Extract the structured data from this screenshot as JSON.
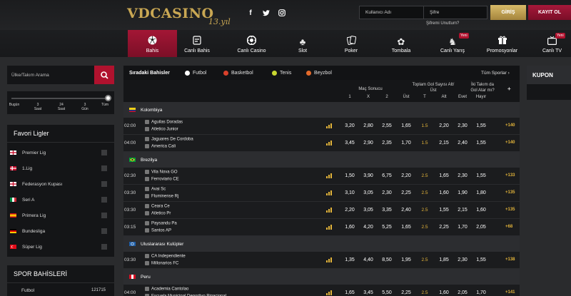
{
  "header": {
    "logo_text": "VDCASINO",
    "logo_sub": "13.yıl",
    "social": [
      "facebook-icon",
      "twitter-icon",
      "instagram-icon"
    ],
    "username_placeholder": "Kullanıcı Adı",
    "password_placeholder": "Şifre",
    "forgot_text": "Şifremi Unuttum?",
    "login_label": "GİRİŞ",
    "register_label": "KAYIT OL"
  },
  "nav": [
    {
      "label": "Bahis",
      "icon": "soccer-ball-icon",
      "active": true
    },
    {
      "label": "Canlı Bahis",
      "icon": "live-bet-icon"
    },
    {
      "label": "Canlı Casino",
      "icon": "casino-chip-icon"
    },
    {
      "label": "Slot",
      "icon": "slot-icon"
    },
    {
      "label": "Poker",
      "icon": "poker-cards-icon"
    },
    {
      "label": "Tombala",
      "icon": "tombala-icon"
    },
    {
      "label": "Canlı Yarış",
      "icon": "horse-icon",
      "badge": "Yeni"
    },
    {
      "label": "Promosyonlar",
      "icon": "gift-icon"
    },
    {
      "label": "Canlı TV",
      "icon": "tv-icon",
      "badge": "Yeni"
    }
  ],
  "sidebar": {
    "search_placeholder": "Ülke/Takım Arama",
    "time_labels": [
      {
        "l1": "Bugün",
        "l2": ""
      },
      {
        "l1": "3",
        "l2": "Saat"
      },
      {
        "l1": "24",
        "l2": "Saat"
      },
      {
        "l1": "3",
        "l2": "Gün"
      },
      {
        "l1": "Tüm",
        "l2": ""
      }
    ],
    "fav_title": "Favori Ligler",
    "fav_leagues": [
      {
        "name": "Premier Lig",
        "flag": "england"
      },
      {
        "name": "1.Lig",
        "flag": "denmark"
      },
      {
        "name": "Federasyon Kupası",
        "flag": "england"
      },
      {
        "name": "Seri A",
        "flag": "italy"
      },
      {
        "name": "Primera Lig",
        "flag": "spain"
      },
      {
        "name": "Bundesliga",
        "flag": "germany"
      },
      {
        "name": "Süper Lig",
        "flag": "turkey"
      }
    ],
    "spor_title": "SPOR BAHİSLERİ",
    "spor_items": [
      {
        "name": "Futbol",
        "count": "121715"
      }
    ]
  },
  "main": {
    "title": "Sıradaki Bahisler",
    "sports": [
      {
        "label": "Futbol",
        "color": "#ffffff"
      },
      {
        "label": "Basketbol",
        "color": "#d9402b"
      },
      {
        "label": "Tenis",
        "color": "#c8d630"
      },
      {
        "label": "Beyzbol",
        "color": "#e36a2a"
      }
    ],
    "all_sports": "Tüm Sporlar ›",
    "col_groups": {
      "mac_sonucu": "Maç Sonucu",
      "gol_l1": "Toplam Gol Sayısı Alt/",
      "gol_l2": "Üst",
      "kg_l1": "İki Takım da",
      "kg_l2": "Gol Atar mı?",
      "plus": "+"
    },
    "sub_heads": [
      "1",
      "X",
      "2",
      "Üst",
      "T",
      "Alt",
      "Evet",
      "Hayır"
    ],
    "leagues": [
      {
        "name": "Kolombiya",
        "flag": "colombia",
        "matches": [
          {
            "time": "02:00",
            "home": "Aguilas Doradas",
            "away": "Atletico Junior",
            "odds": [
              "3,20",
              "2,80",
              "2,55",
              "1,65",
              "1.5",
              "2,20",
              "2,30",
              "1,55"
            ],
            "more": "+140"
          },
          {
            "time": "04:00",
            "home": "Jaguares De Cordoba",
            "away": "America Cali",
            "odds": [
              "3,45",
              "2,90",
              "2,35",
              "1,70",
              "1.5",
              "2,15",
              "2,40",
              "1,55"
            ],
            "more": "+140"
          }
        ]
      },
      {
        "name": "Brezilya",
        "flag": "brazil",
        "matches": [
          {
            "time": "02:30",
            "home": "Vila Nova GO",
            "away": "Ferroviario CE",
            "odds": [
              "1,50",
              "3,90",
              "6,75",
              "2,20",
              "2.5",
              "1,65",
              "2,30",
              "1,55"
            ],
            "more": "+133"
          },
          {
            "time": "03:30",
            "home": "Avai Sc",
            "away": "Fluminense Rj",
            "odds": [
              "3,10",
              "3,05",
              "2,30",
              "2,25",
              "2.5",
              "1,60",
              "1,90",
              "1,80"
            ],
            "more": "+135"
          },
          {
            "time": "03:30",
            "home": "Ceara Ce",
            "away": "Atletico Pr",
            "odds": [
              "2,20",
              "3,05",
              "3,35",
              "2,40",
              "2.5",
              "1,55",
              "2,15",
              "1,60"
            ],
            "more": "+135"
          },
          {
            "time": "03:15",
            "home": "Paysandu Pa",
            "away": "Santos AP",
            "odds": [
              "1,60",
              "4,20",
              "5,25",
              "1,65",
              "2.5",
              "2,25",
              "1,70",
              "2,05"
            ],
            "more": "+68"
          }
        ]
      },
      {
        "name": "Uluslararası Kulüpler",
        "flag": "intl",
        "matches": [
          {
            "time": "03:30",
            "home": "CA Independiente",
            "away": "Millonarios FC",
            "odds": [
              "1,35",
              "4,40",
              "8,50",
              "1,95",
              "2.5",
              "1,85",
              "2,30",
              "1,55"
            ],
            "more": "+138"
          }
        ]
      },
      {
        "name": "Peru",
        "flag": "peru",
        "matches": [
          {
            "time": "04:00",
            "home": "Academia Cantolao",
            "away": "Escuela Municipal Deportivo Binacional",
            "odds": [
              "1,65",
              "3,45",
              "5,50",
              "2,25",
              "2.5",
              "1,60",
              "2,05",
              "1,70"
            ],
            "more": "+141"
          }
        ]
      }
    ]
  },
  "kupon": {
    "title": "KUPON"
  }
}
